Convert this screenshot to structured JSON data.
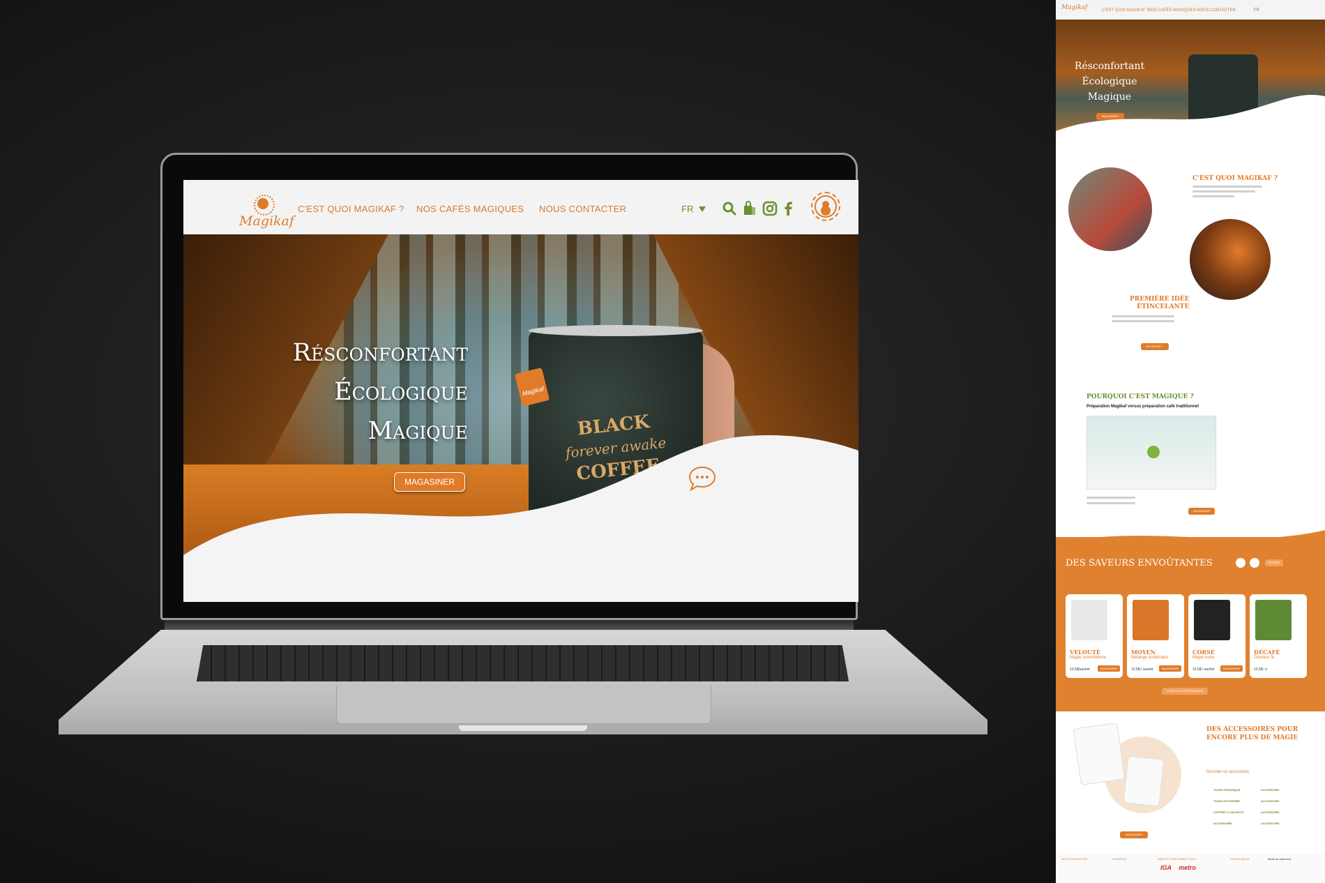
{
  "site": {
    "logo_text": "Magikaf",
    "nav": {
      "items": [
        "C'EST QUOI MAGIKAF ?",
        "NOS CAFÉS MAGIQUES",
        "NOUS CONTACTER"
      ],
      "lang": "FR"
    },
    "hero": {
      "headline": [
        "Résconfortant",
        "Écologique",
        "Magique"
      ],
      "cta": "MAGASINER",
      "mug_text": {
        "top": "BLACK",
        "middle": "forever awake",
        "bottom": "COFFEE"
      },
      "tag_text": "Magikaf"
    }
  },
  "thumbnail": {
    "nav": [
      "C'EST QUOI MAGIKAF ?",
      "NOS CAFÉS MAGIQUES",
      "NOUS CONTACTER",
      "FR"
    ],
    "hero_headline": [
      "Résconfortant",
      "Écologique",
      "Magique"
    ],
    "hero_cta": "MAGASINER",
    "section_what": "C'EST QUOI MAGIKAF ?",
    "section_first_idea": [
      "PREMIÈRE IDÉE",
      "ÉTINCELANTE"
    ],
    "first_idea_button": "EN SAVOIR +",
    "section_why": "POURQUOI C'EST MAGIQUE ?",
    "why_subtitle": "Préparation Magikaf versus préparation café traditionnel",
    "why_button": "MAGASINER",
    "flavours_title": "DES SAVEURS ENVOÛTANTES",
    "flavours_filter": "FILTRER",
    "products": [
      {
        "name": "VELOUTÉ",
        "desc": "Magie colombienne",
        "price": "12,5$/sachet",
        "button": "MAGASINER",
        "color": "#e9e9e9"
      },
      {
        "name": "MOYEN",
        "desc": "Mélange ésotérique",
        "price": "12,5$ / sachet",
        "button": "MAGASINER",
        "color": "#d9762a"
      },
      {
        "name": "CORSÉ",
        "desc": "Magie noire",
        "price": "12,5$ / sachet",
        "button": "MAGASINER",
        "color": "#222222"
      },
      {
        "name": "DÉCAFÉ",
        "desc": "Douceur fé",
        "price": "12,5$ / s",
        "button": "",
        "color": "#5f8a35"
      }
    ],
    "see_all": "VOIR TOUS LES PRODUITS",
    "accessories_title": [
      "DES ACCESSOIRES POUR",
      "ENCORE PLUS DE MAGIE"
    ],
    "accessories_link": "Survoler un accessoire",
    "accessories_list": [
      [
        "TASSE CÉRAMIQUE",
        "ACCESSOIRE"
      ],
      [
        "TASSE ISOTHERME",
        "ACCESSOIRE"
      ],
      [
        "COFFRET À SACHETS",
        "ACCESSOIRE"
      ],
      [
        "ACCESSOIRE",
        "ACCESSOIRE"
      ]
    ],
    "accessories_button": "MAGASINER",
    "footer": {
      "contact": "NOUS CONTACTER",
      "delivery": "LIVRAISON",
      "available": "BIENTÔT DISPONIBLE CHEZ :",
      "follow": "SUIVEZ-NOUS",
      "payment": "Mode de paiement",
      "stores": [
        "IGA",
        "metro"
      ]
    }
  },
  "colors": {
    "accent": "#e07b2a",
    "green": "#6b8f2f",
    "nav_bg": "#f3f3f3"
  }
}
